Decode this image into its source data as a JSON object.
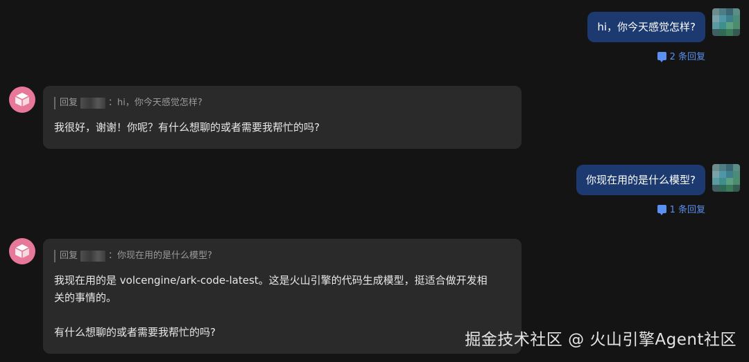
{
  "messages": [
    {
      "role": "user",
      "text": "hi，你今天感觉怎样?",
      "reply_count": "2 条回复"
    },
    {
      "role": "assistant",
      "reply_prefix": "回复",
      "quoted_text": "：hi，你今天感觉怎样?",
      "lines": [
        "我很好，谢谢！你呢？有什么想聊的或者需要我帮忙的吗?"
      ]
    },
    {
      "role": "user",
      "text": "你现在用的是什么模型?",
      "reply_count": "1 条回复"
    },
    {
      "role": "assistant",
      "reply_prefix": "回复",
      "quoted_text": "：你现在用的是什么模型?",
      "lines": [
        "我现在用的是 volcengine/ark-code-latest。这是火山引擎的代码生成模型，挺适合做开发相",
        "关的事情的。",
        "有什么想聊的或者需要我帮忙的吗?"
      ]
    }
  ],
  "watermark": "掘金技术社区 @ 火山引擎Agent社区",
  "colors": {
    "background": "#141414",
    "user_bubble": "#1c3a70",
    "bot_bubble": "#2a2a2a",
    "reply_link": "#5b8ff0",
    "bot_avatar": "#e7789a"
  }
}
